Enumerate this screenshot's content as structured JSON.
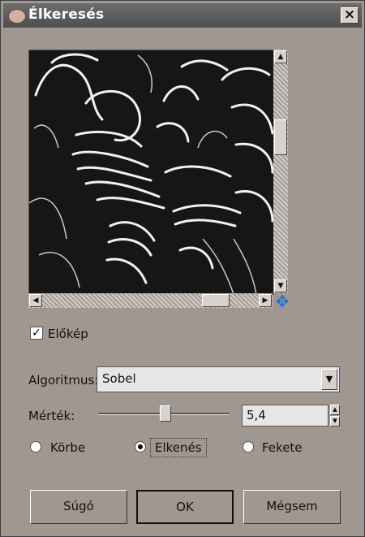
{
  "window": {
    "title": "Élkeresés",
    "close_label": "×"
  },
  "preview": {
    "checkbox_label": "Előkép",
    "checked": true
  },
  "algorithm": {
    "label": "Algoritmus:",
    "value": "Sobel"
  },
  "amount": {
    "label": "Mérték:",
    "value": "5,4",
    "slider_fraction": 0.51
  },
  "edge_mode": {
    "options": [
      "Körbe",
      "Elkenés",
      "Fekete"
    ],
    "selected": "Elkenés"
  },
  "buttons": {
    "help": "Súgó",
    "ok": "OK",
    "cancel": "Mégsem"
  },
  "icons": {
    "title": "wilber-icon",
    "nav": "navigate-move-icon"
  }
}
